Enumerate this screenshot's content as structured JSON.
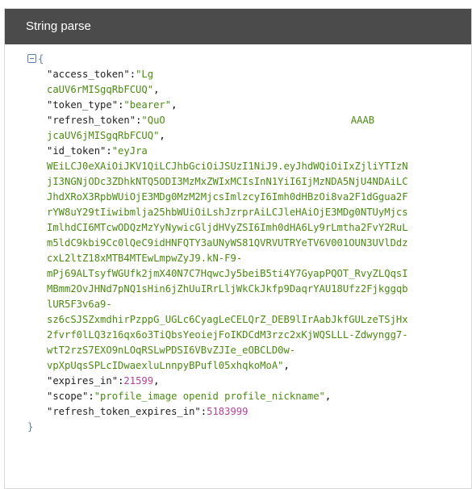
{
  "panel": {
    "title": "String parse"
  },
  "json": {
    "open_brace": "{",
    "close_brace": "}",
    "entries": {
      "access_token": {
        "key": "\"access_token\"",
        "value_start": "\"Lg",
        "value_end": "caUV6rMISgqRbFCUQ\""
      },
      "token_type": {
        "key": "\"token_type\"",
        "value": "\"bearer\""
      },
      "refresh_token": {
        "key": "\"refresh_token\"",
        "value_start": "\"QuO",
        "value_mid": "AAAB",
        "value_end": "jcaUV6jMISgqRbFCUQ\""
      },
      "id_token": {
        "key": "\"id_token\"",
        "value_start": "\"eyJra",
        "value_mid": "...",
        "lines": [
          "WEiLCJ0eXAiOiJKV1QiLCJhbGciOiJSUzI1NiJ9.eyJhdWQiOiIxZjliYTIzN",
          "jI3NGNjODc3ZDhkNTQ5ODI3MzMxZWIxMCIsInN1YiI6IjMzNDA5NjU4NDAiLC",
          "JhdXRoX3RpbWUiOjE3MDg0MzM2MjcsImlzcyI6Imh0dHBzOi8va2F1dGgua2F",
          "rYW8uY29tIiwibmlja25hbWUiOiLshJzrprAiLCJleHAiOjE3MDg0NTUyMjcs",
          "ImlhdCI6MTcwODQzMzYyNywicGljdHVyZSI6Imh0dHA6Ly9rLmtha2FvY2RuL",
          "m5ldC9kbi9Cc0lQeC9idHNFQTY3aUNyWS81QVRVUTRYeTV6V001OUN3UVlDdz",
          "cxL2ltZ18xMTB4MTEwLmpwZyJ9.kN-F9-",
          "mPj69ALTsyfWGUfk2jmX40N7C7HqwcJy5beiB5ti4Y7GyapPQOT_RvyZLQqsI",
          "MBmm2OvJHNd7pNQ1sHin6jZhUuIRrLljWkCkJkfp9DaqrYAU18Ufz2Fjkggqb",
          "lUR5F3v6a9-",
          "sz6cSJSZxmdhirPzppG_UGLc6CyagLeCELQrZ_DEB9lIrAabJkfGULzeTSjHx",
          "2fvrf0lLQ3z16qx6o3TiQbsYeoiejFoIKDCdM3rzc2xKjWQSLLL-Zdwyngg7-",
          "wtT2rzS7EXO9nLOqRSLwPDSI6VBvZJIe_eOBCLD0w-",
          "vpXpUqsSPLcIDwaexluLnnpyBPufl05xhqkoMoA\""
        ]
      },
      "expires_in": {
        "key": "\"expires_in\"",
        "value": 21599
      },
      "scope": {
        "key": "\"scope\"",
        "value": "\"profile_image openid profile_nickname\""
      },
      "refresh_token_expires_in": {
        "key": "\"refresh_token_expires_in\"",
        "value": 5183999
      }
    }
  },
  "colors": {
    "header_bg": "#4b4b4b",
    "string": "#4b8b12",
    "number": "#b0429a",
    "brace": "#5a7fb0"
  }
}
